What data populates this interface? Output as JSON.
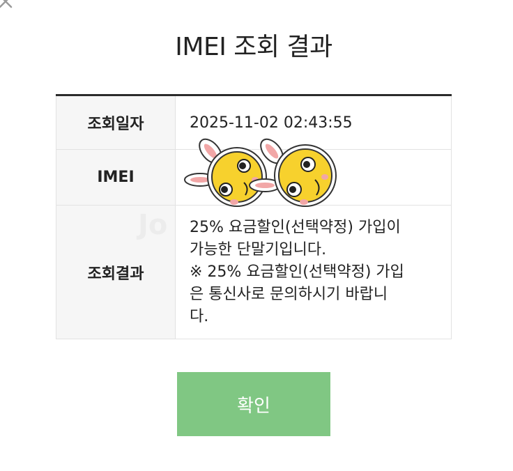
{
  "title": "IMEI 조회 결과",
  "table": {
    "rows": [
      {
        "label": "조회일자",
        "value": "2025-11-02 02:43:55"
      },
      {
        "label": "IMEI",
        "value": ""
      },
      {
        "label": "조회결과",
        "value": "25% 요금할인(선택약정) 가입이\n가능한 단말기입니다.\n※ 25% 요금할인(선택약정) 가입\n은 통신사로 문의하시기 바랍니\n다."
      }
    ]
  },
  "confirm_button": {
    "label": "확인"
  },
  "colors": {
    "confirm_button_bg": "#80c783",
    "header_bg": "#f6f6f6",
    "table_top_border": "#2b2b2b"
  },
  "icons": [
    "close-icon",
    "bunny-sticker-icon"
  ]
}
